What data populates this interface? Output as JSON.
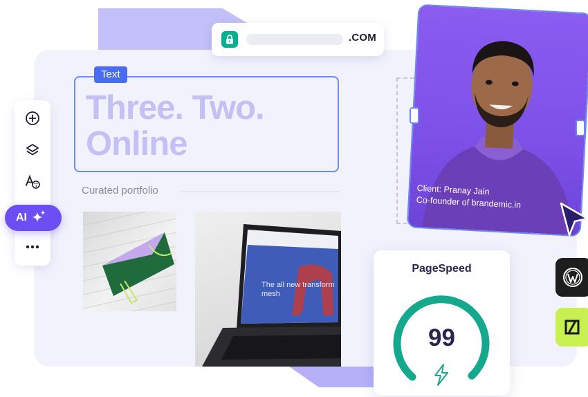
{
  "url_bar": {
    "tld": ".COM",
    "lock_icon": "lock-icon"
  },
  "toolbar": {
    "items": [
      {
        "name": "add",
        "icon": "plus-circle-icon"
      },
      {
        "name": "layers",
        "icon": "layers-icon"
      },
      {
        "name": "fonts-colors",
        "icon": "font-palette-icon"
      }
    ],
    "ai_label": "AI",
    "ai_icon": "sparkles-icon",
    "more_icon": "more-dots-icon"
  },
  "editor": {
    "tag": "Text",
    "headline_line1": "Three. Two.",
    "headline_line2": "Online",
    "section_label": "Curated portfolio"
  },
  "laptop_screen": {
    "caption": "The all new transform mesh"
  },
  "profile": {
    "client_line": "Client: Pranay Jain",
    "role_line": "Co-founder of brandemic.in"
  },
  "pagespeed": {
    "title": "PageSpeed",
    "score": "99",
    "score_fraction": 0.99
  },
  "platforms": [
    "wordpress-icon",
    "lime-builder-icon"
  ],
  "colors": {
    "accent_purple": "#6c4ff2",
    "text_tag_blue": "#4a6df0",
    "pagespeed_green": "#14a98c",
    "lock_green": "#00b090",
    "lime_badge": "#c8f051"
  }
}
